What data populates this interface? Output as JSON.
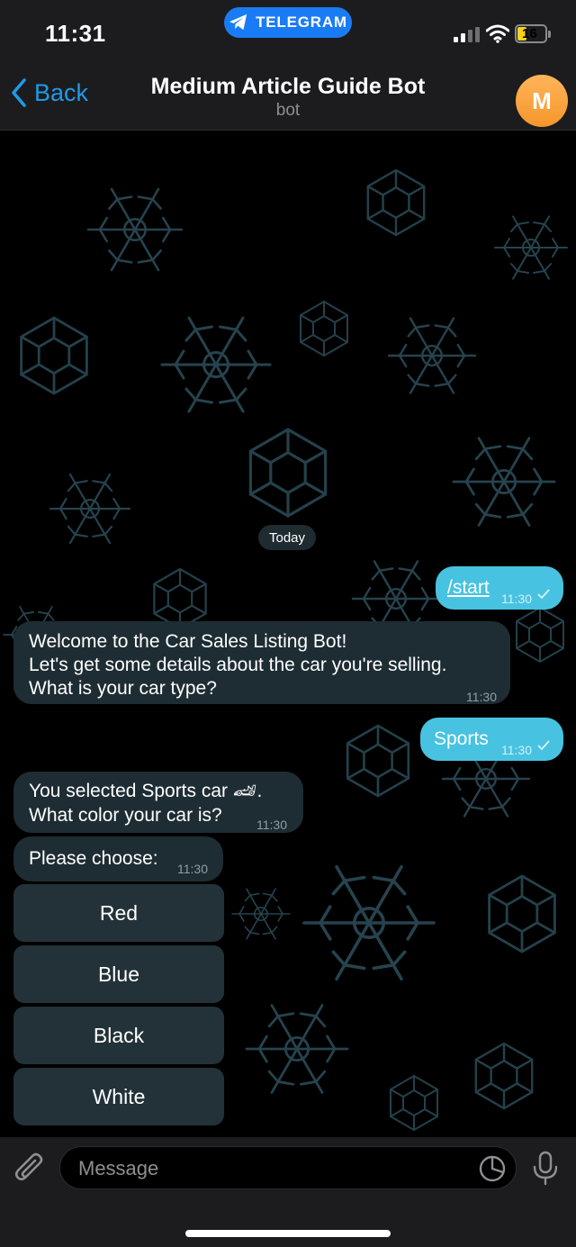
{
  "status": {
    "time": "11:31",
    "pill_label": "TELEGRAM",
    "battery": "16"
  },
  "header": {
    "back_label": "Back",
    "title": "Medium Article Guide Bot",
    "subtitle": "bot",
    "avatar_letter": "M"
  },
  "chat": {
    "date": "Today",
    "messages": [
      {
        "text": "/start",
        "time": "11:30"
      },
      {
        "line1": "Welcome to the Car Sales Listing Bot!",
        "line2": "Let's get some details about the car you're selling.",
        "line3": "What is your car type?",
        "time": "11:30"
      },
      {
        "text": "Sports",
        "time": "11:30"
      },
      {
        "line1": "You selected Sports car 🏎.",
        "line2": "What color your car is?",
        "time": "11:30"
      },
      {
        "text": "Please choose:",
        "time": "11:30"
      }
    ],
    "keyboard": [
      "Red",
      "Blue",
      "Black",
      "White"
    ]
  },
  "input": {
    "placeholder": "Message"
  },
  "colors": {
    "accent": "#1e9be8",
    "outgoing_bubble": "#47c3e1",
    "incoming_bubble": "#1e2d33",
    "avatar": "#f5962b"
  },
  "icons": [
    "chevron-left-icon",
    "telegram-plane-icon",
    "signal-icon",
    "wifi-icon",
    "battery-icon",
    "check-icon",
    "paperclip-icon",
    "sticker-icon",
    "microphone-icon"
  ]
}
